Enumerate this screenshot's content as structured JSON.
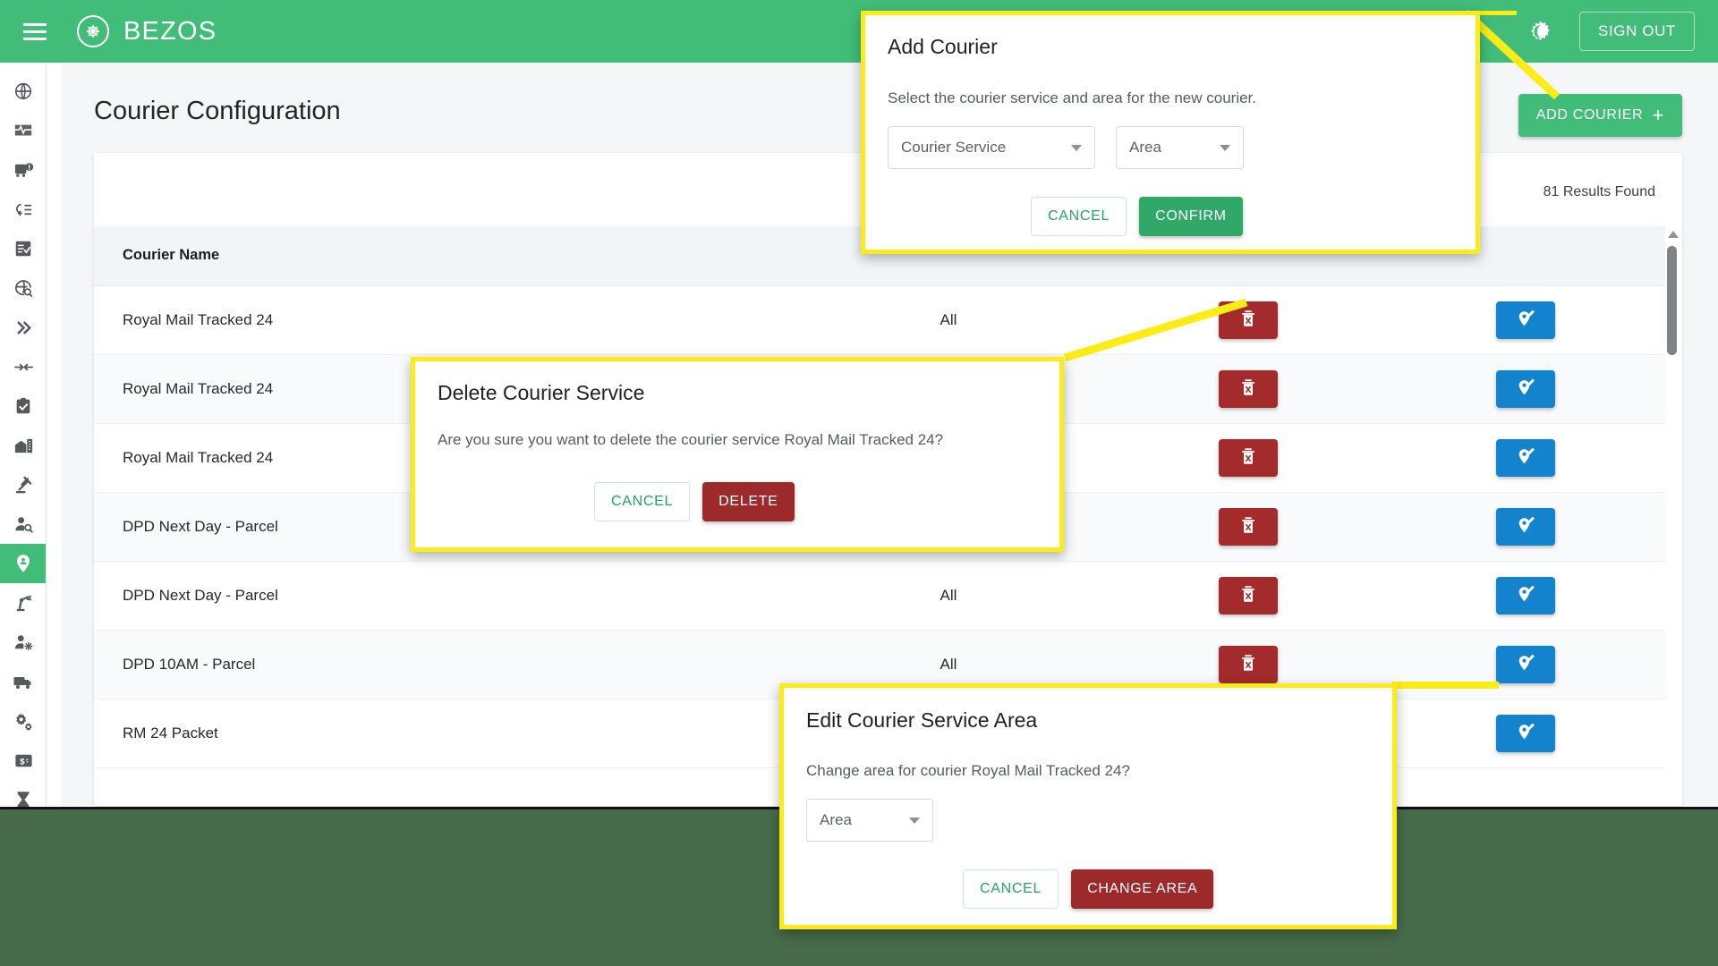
{
  "topbar": {
    "menu_icon": "hamburger-menu-icon",
    "logo_icon": "bezos-snowflake-logo-icon",
    "brand": "BEZOS",
    "brightness_icon": "brightness-moon-icon",
    "signout_label": "SIGN OUT"
  },
  "sidebar": {
    "items": [
      {
        "icon": "globe-icon",
        "active": false
      },
      {
        "icon": "monitor-pulse-icon",
        "active": false
      },
      {
        "icon": "bus-alert-icon",
        "active": false
      },
      {
        "icon": "list-return-icon",
        "active": false
      },
      {
        "icon": "checklist-icon",
        "active": false
      },
      {
        "icon": "globe-search-icon",
        "active": false
      },
      {
        "icon": "chevrons-right-icon",
        "active": false
      },
      {
        "icon": "arrows-collapse-icon",
        "active": false
      },
      {
        "icon": "clipboard-check-icon",
        "active": false
      },
      {
        "icon": "warehouse-icon",
        "active": false
      },
      {
        "icon": "gavel-icon",
        "active": false
      },
      {
        "icon": "user-search-icon",
        "active": false
      },
      {
        "icon": "location-pin-user-icon",
        "active": true
      },
      {
        "icon": "robot-arm-icon",
        "active": false
      },
      {
        "icon": "user-settings-icon",
        "active": false
      },
      {
        "icon": "truck-icon",
        "active": false
      },
      {
        "icon": "gears-icon",
        "active": false
      },
      {
        "icon": "money-card-icon",
        "active": false
      },
      {
        "icon": "hourglass-icon",
        "active": false
      }
    ]
  },
  "page": {
    "title": "Courier Configuration",
    "add_courier_label": "ADD COURIER",
    "add_courier_icon": "plus-icon",
    "results_found": "81 Results Found"
  },
  "table": {
    "columns": [
      "Courier Name",
      "",
      "",
      ""
    ],
    "header_name": "Courier Name",
    "delete_icon": "trash-delete-icon",
    "edit_icon": "location-pin-edit-icon",
    "rows": [
      {
        "name": "Royal Mail Tracked 24",
        "area": "All"
      },
      {
        "name": "Royal Mail Tracked 24",
        "area": ""
      },
      {
        "name": "Royal Mail Tracked 24",
        "area": ""
      },
      {
        "name": "DPD Next Day - Parcel",
        "area": ""
      },
      {
        "name": "DPD Next Day - Parcel",
        "area": "All"
      },
      {
        "name": "DPD 10AM - Parcel",
        "area": "All"
      },
      {
        "name": "RM 24 Packet",
        "area": ""
      }
    ]
  },
  "dialogs": {
    "add_courier": {
      "title": "Add Courier",
      "body": "Select the courier service and area for the new courier.",
      "select_service": "Courier Service",
      "select_area": "Area",
      "cancel_label": "CANCEL",
      "confirm_label": "CONFIRM"
    },
    "delete_courier": {
      "title": "Delete Courier Service",
      "body": "Are you sure you want to delete the courier service Royal Mail Tracked 24?",
      "cancel_label": "CANCEL",
      "delete_label": "DELETE"
    },
    "edit_area": {
      "title": "Edit Courier Service Area",
      "body": "Change area for courier Royal Mail Tracked 24?",
      "select_area": "Area",
      "cancel_label": "CANCEL",
      "change_label": "CHANGE AREA"
    }
  },
  "colors": {
    "brand_green": "#41bd79",
    "highlight_yellow": "#fbec18",
    "danger_red": "#a32b2b",
    "edit_blue": "#1483cd",
    "backdrop_green": "#476b4b"
  }
}
